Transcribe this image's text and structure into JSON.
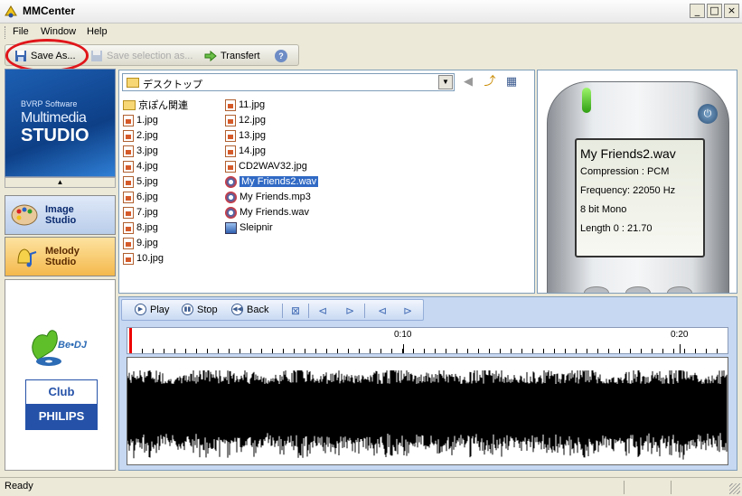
{
  "window": {
    "title": "MMCenter",
    "minimize": "_",
    "maximize": "□",
    "close": "×"
  },
  "menu": [
    "File",
    "Window",
    "Help"
  ],
  "toolbar": {
    "save_as": "Save As...",
    "save_selection": "Save selection as...",
    "transfert": "Transfert",
    "help": "?"
  },
  "sidebar": {
    "logo_line1": "BVRP Software",
    "logo_line2": "Multimedia",
    "logo_line3": "STUDIO",
    "collapse": "▲",
    "image_studio": "Image Studio",
    "melody_studio": "Melody Studio",
    "bedj": "Be•DJ",
    "club": "Club",
    "philips": "PHILIPS"
  },
  "browser": {
    "path": "デスクトップ",
    "files_col1": [
      {
        "name": "京ぽん関連",
        "type": "folder"
      },
      {
        "name": "1.jpg",
        "type": "jpg"
      },
      {
        "name": "2.jpg",
        "type": "jpg"
      },
      {
        "name": "3.jpg",
        "type": "jpg"
      },
      {
        "name": "4.jpg",
        "type": "jpg"
      },
      {
        "name": "5.jpg",
        "type": "jpg"
      },
      {
        "name": "6.jpg",
        "type": "jpg"
      },
      {
        "name": "7.jpg",
        "type": "jpg"
      },
      {
        "name": "8.jpg",
        "type": "jpg"
      },
      {
        "name": "9.jpg",
        "type": "jpg"
      },
      {
        "name": "10.jpg",
        "type": "jpg"
      }
    ],
    "files_col2": [
      {
        "name": "11.jpg",
        "type": "jpg"
      },
      {
        "name": "12.jpg",
        "type": "jpg"
      },
      {
        "name": "13.jpg",
        "type": "jpg"
      },
      {
        "name": "14.jpg",
        "type": "jpg"
      },
      {
        "name": "CD2WAV32.jpg",
        "type": "jpg"
      },
      {
        "name": "My Friends2.wav",
        "type": "wav",
        "selected": true
      },
      {
        "name": "My Friends.mp3",
        "type": "wav"
      },
      {
        "name": "My Friends.wav",
        "type": "wav"
      },
      {
        "name": "Sleipnir",
        "type": "shortcut"
      }
    ]
  },
  "device": {
    "file": "My Friends2.wav",
    "compression": "Compression : PCM",
    "frequency": "Frequency: 22050 Hz",
    "format": "8 bit Mono",
    "length": "Length 0 : 21.70",
    "power": "⏻"
  },
  "player": {
    "play": "Play",
    "stop": "Stop",
    "back": "Back",
    "ticks": [
      "0:10",
      "0:20"
    ]
  },
  "status": {
    "text": "Ready"
  },
  "colors": {
    "accent": "#316ac5",
    "highlight_ring": "#e0161b",
    "cursor": "#e00000"
  }
}
